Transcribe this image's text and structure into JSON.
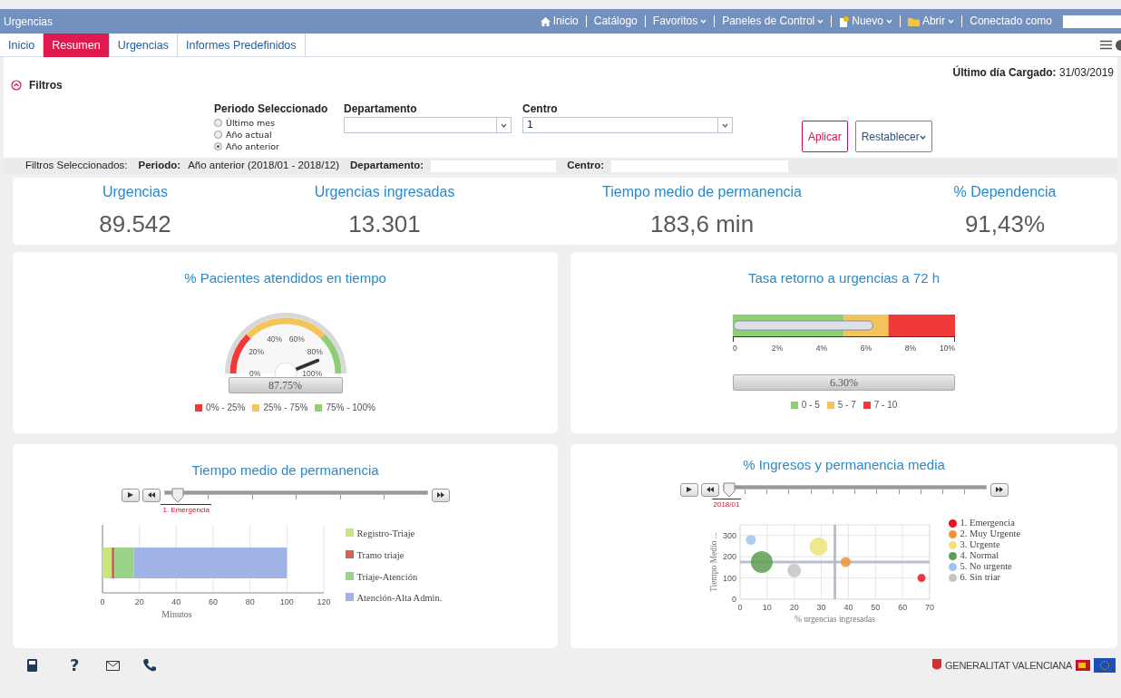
{
  "window": {
    "title": "Urgencias"
  },
  "top_menu": [
    {
      "label": "Inicio",
      "kind": "home"
    },
    {
      "label": "Catálogo",
      "kind": "link"
    },
    {
      "label": "Favoritos",
      "kind": "dropdown"
    },
    {
      "label": "Paneles de Control",
      "kind": "dropdown"
    },
    {
      "label": "Nuevo",
      "kind": "new"
    },
    {
      "label": "Abrir",
      "kind": "open"
    },
    {
      "label": "Conectado como",
      "kind": "user"
    }
  ],
  "tabs": [
    {
      "label": "Inicio",
      "selected": false
    },
    {
      "label": "Resumen",
      "selected": true
    },
    {
      "label": "Urgencias",
      "selected": false
    },
    {
      "label": "Informes Predefinidos",
      "selected": false
    }
  ],
  "last_loaded": {
    "label": "Último día Cargado:",
    "value": "31/03/2019"
  },
  "filters": {
    "title": "Filtros",
    "expanded": true,
    "period": {
      "label": "Periodo Seleccionado",
      "options": [
        {
          "label": "Último mes",
          "selected": false
        },
        {
          "label": "Año actual",
          "selected": false
        },
        {
          "label": "Año anterior",
          "selected": true
        }
      ]
    },
    "department": {
      "label": "Departamento"
    },
    "center": {
      "label": "Centro",
      "value": "1"
    },
    "buttons": [
      {
        "label": "Aplicar",
        "kind": "primary"
      },
      {
        "label": "Restablecer",
        "kind": "dropdown"
      }
    ]
  },
  "selected_filters": {
    "label": "Filtros Seleccionados:",
    "items": [
      {
        "label": "Periodo:",
        "value": "Año anterior (2018/01 - 2018/12)"
      },
      {
        "label": "Departamento:"
      },
      {
        "label": "Centro:"
      }
    ]
  },
  "kpis": [
    {
      "label": "Urgencias",
      "value": "89.542"
    },
    {
      "label": "Urgencias ingresadas",
      "value": "13.301"
    },
    {
      "label": "Tiempo medio de permanencia",
      "value": "183,6 min"
    },
    {
      "label": "% Dependencia",
      "value": "91,43%"
    }
  ],
  "panels": [
    {
      "kind": "gauge",
      "title": "% Pacientes atendidos en tiempo",
      "reading": "87.75%",
      "ticks": [
        "0%",
        "20%",
        "40%",
        "60%",
        "80%",
        "100%"
      ],
      "legend": [
        {
          "label": "0% - 25%",
          "color": "#f03a3a"
        },
        {
          "label": "25% - 75%",
          "color": "#f2c45a"
        },
        {
          "label": "75% - 100%",
          "color": "#8dcf74"
        }
      ]
    },
    {
      "kind": "bullet",
      "title": "Tasa retorno a urgencias a 72 h",
      "level": 0.63,
      "reading": "6.30%",
      "ticks": [
        "0",
        "2%",
        "4%",
        "6%",
        "8%",
        "10%"
      ],
      "legend": [
        {
          "label": "0 - 5",
          "color": "#8dcf74"
        },
        {
          "label": "5 - 7",
          "color": "#f2c45a"
        },
        {
          "label": "7 - 10",
          "color": "#f03a3a"
        }
      ]
    },
    {
      "kind": "stacked_bar",
      "title": "Tiempo medio de permanencia",
      "slider": {
        "level": 0.03,
        "label": "1. Emergencia"
      },
      "chart_data": {
        "type": "bar",
        "orientation": "horizontal",
        "stacked": true,
        "grid": true,
        "xlabel": "Minutos",
        "xlim": [
          0,
          120
        ],
        "xticks": [
          0,
          20,
          40,
          60,
          80,
          100,
          120
        ],
        "series": [
          {
            "name": "Registro-Triaje",
            "color": "#c8e67a",
            "values": [
              5
            ]
          },
          {
            "name": "Tramo triaje",
            "color": "#d9605a",
            "values": [
              1.5
            ]
          },
          {
            "name": "Triaje-Atención",
            "color": "#9bd38a",
            "values": [
              10.5
            ]
          },
          {
            "name": "Atención-Alta Admin.",
            "color": "#9fb3e6",
            "values": [
              83
            ]
          }
        ]
      }
    },
    {
      "kind": "bubble",
      "title": "% Ingresos y permanencia media",
      "slider": {
        "level": 0.0,
        "label": "2018/01"
      },
      "chart_data": {
        "type": "scatter",
        "grid": true,
        "xlabel": "% urgencias ingresadas",
        "ylabel": "Tiempo Medio ...",
        "xlim": [
          0,
          70
        ],
        "ylim": [
          0,
          350
        ],
        "xticks": [
          0,
          10,
          20,
          30,
          40,
          50,
          60,
          70
        ],
        "yticks": [
          0,
          100,
          200,
          300
        ],
        "series": [
          {
            "name": "1. Emergencia",
            "color": "#e8141b",
            "x": [
              67
            ],
            "values": [
              100
            ]
          },
          {
            "name": "2. Muy Urgente",
            "color": "#f39233",
            "x": [
              39
            ],
            "values": [
              175
            ]
          },
          {
            "name": "3. Urgente",
            "color": "#ece27a",
            "x": [
              29
            ],
            "values": [
              248
            ]
          },
          {
            "name": "4. Normal",
            "color": "#5e9e4f",
            "x": [
              8
            ],
            "values": [
              175
            ]
          },
          {
            "name": "5. No urgente",
            "color": "#9cc6f2",
            "x": [
              4
            ],
            "values": [
              280
            ]
          },
          {
            "name": "6. Sin triar",
            "color": "#c4c4c4",
            "x": [
              20
            ],
            "values": [
              135
            ]
          }
        ],
        "ref_lines": [
          {
            "axis": "x",
            "value": 35
          },
          {
            "axis": "y",
            "value": 175
          }
        ]
      }
    }
  ],
  "footer": {
    "help": "?",
    "logo": "GENERALITAT VALENCIANA"
  }
}
